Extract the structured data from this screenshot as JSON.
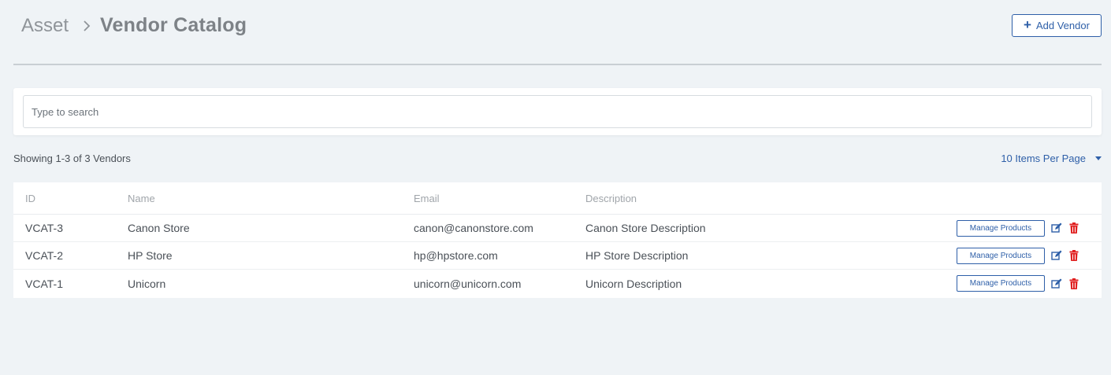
{
  "breadcrumb": {
    "root": "Asset",
    "current": "Vendor Catalog"
  },
  "header": {
    "add_button_label": "Add Vendor"
  },
  "search": {
    "placeholder": "Type to search",
    "value": ""
  },
  "summary": {
    "showing_text": "Showing 1-3 of 3 Vendors",
    "per_page_label": "10 Items Per Page"
  },
  "table": {
    "columns": [
      "ID",
      "Name",
      "Email",
      "Description"
    ],
    "rows": [
      {
        "id": "VCAT-3",
        "name": "Canon Store",
        "email": "canon@canonstore.com",
        "description": "Canon Store Description",
        "action_label": "Manage Products"
      },
      {
        "id": "VCAT-2",
        "name": "HP Store",
        "email": "hp@hpstore.com",
        "description": "HP Store Description",
        "action_label": "Manage Products"
      },
      {
        "id": "VCAT-1",
        "name": "Unicorn",
        "email": "unicorn@unicorn.com",
        "description": "Unicorn Description",
        "action_label": "Manage Products"
      }
    ]
  },
  "icons": {
    "separator": "chevron-right-icon",
    "add": "plus-icon",
    "edit": "edit-icon",
    "delete": "trash-icon"
  },
  "colors": {
    "accent": "#2e5fa8",
    "danger": "#e02020",
    "background": "#eff3f6"
  }
}
